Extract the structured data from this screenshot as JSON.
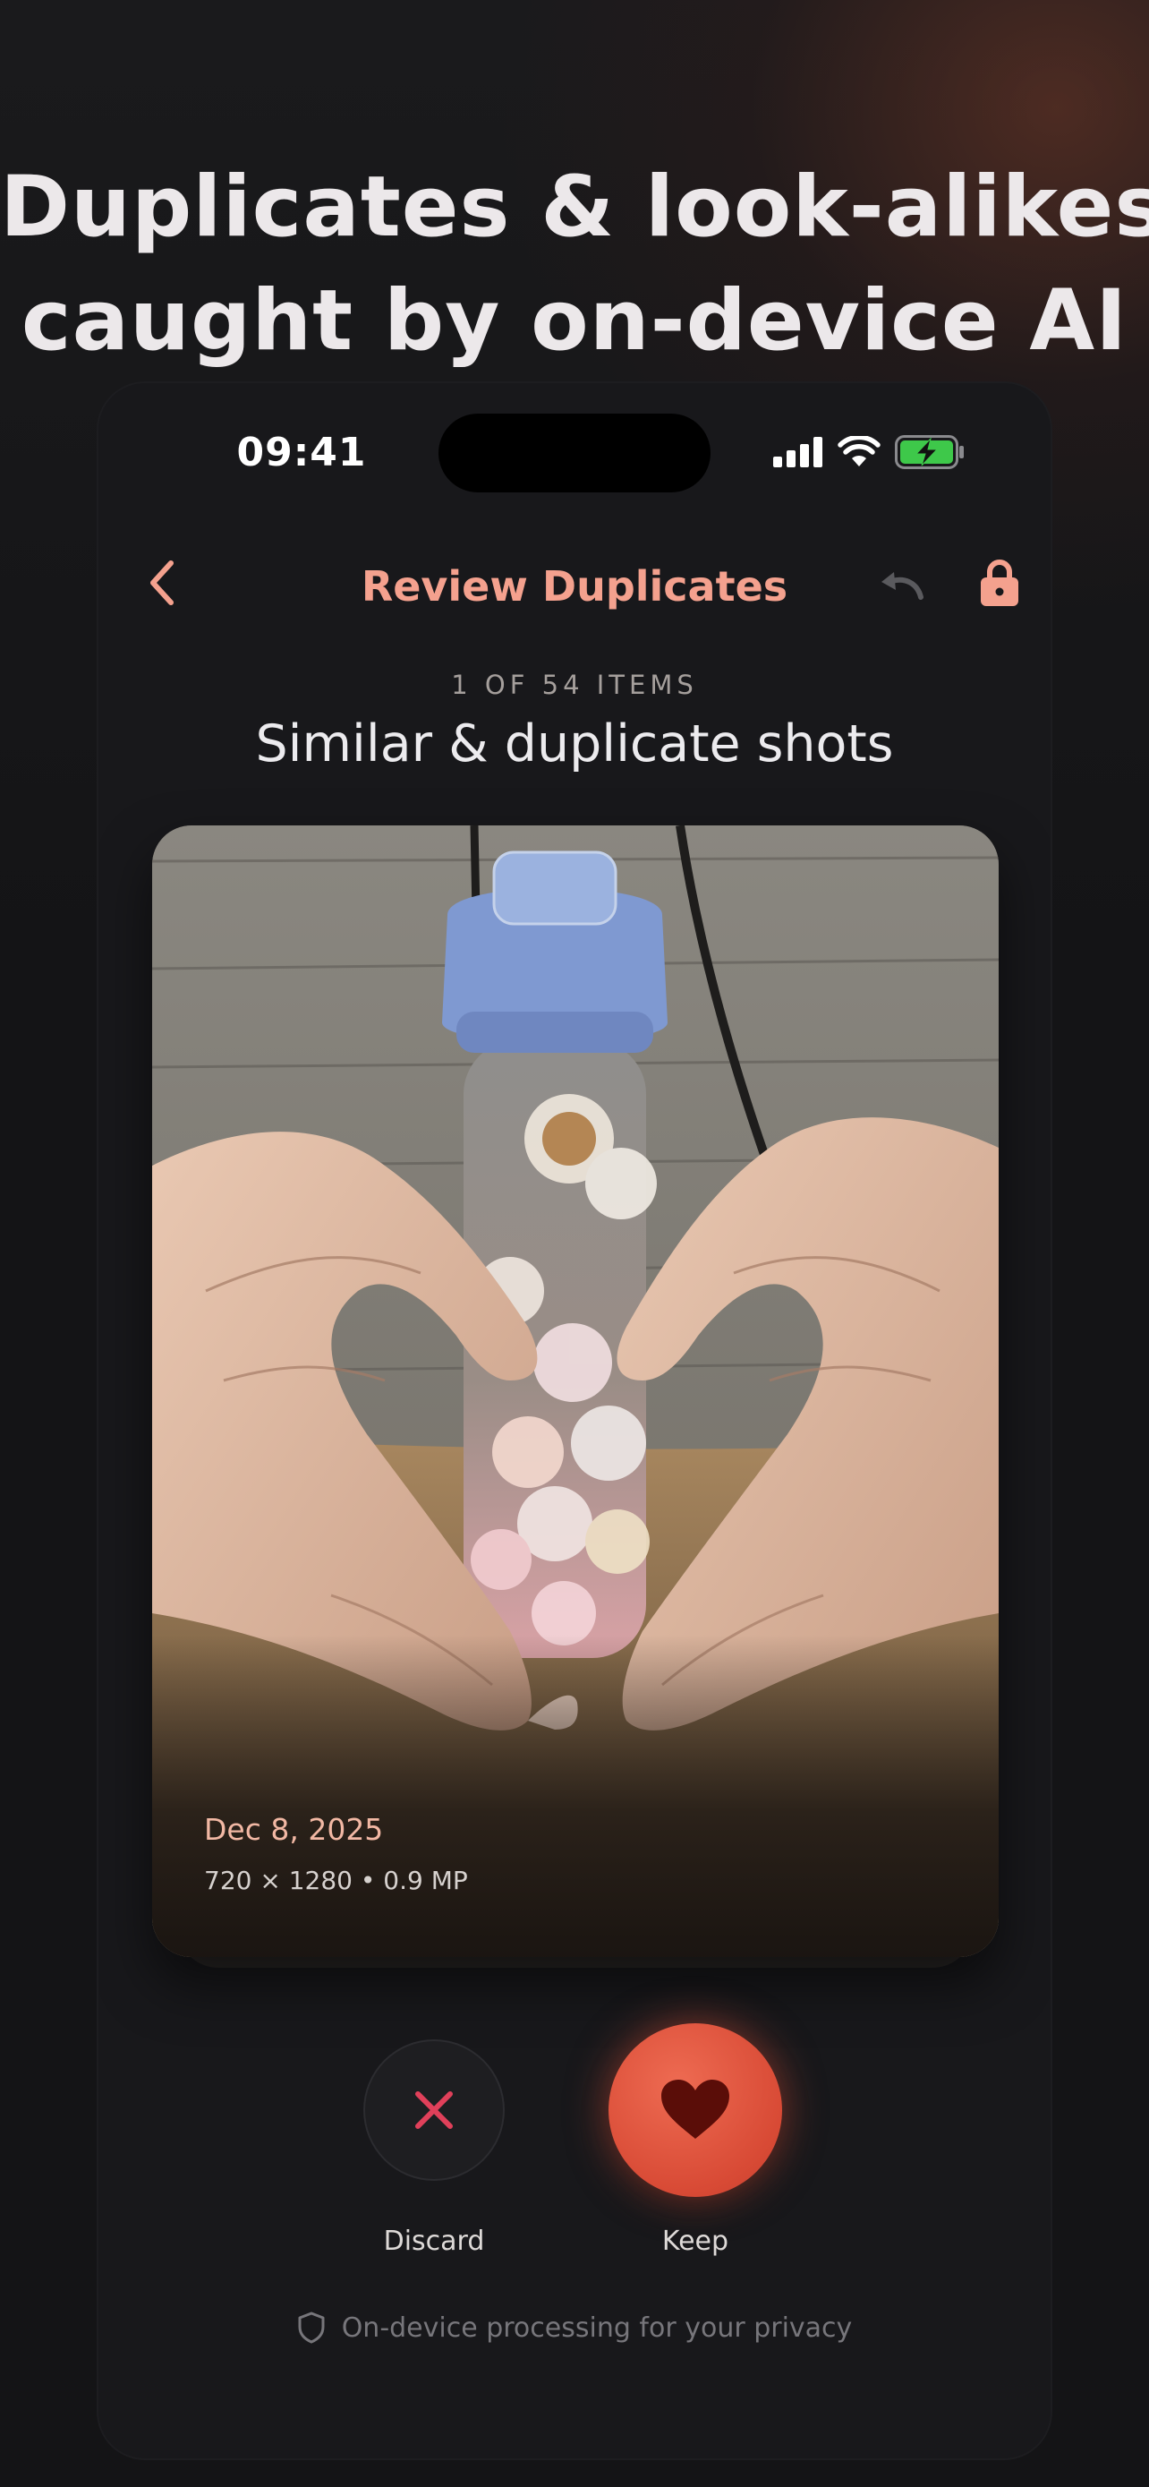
{
  "headline": {
    "line1": "Duplicates & look-alikes,",
    "line2": "caught by on-device AI"
  },
  "status_bar": {
    "time": "09:41",
    "icons": [
      "cellular-signal-icon",
      "wifi-icon",
      "battery-charging-icon"
    ]
  },
  "nav": {
    "title": "Review Duplicates",
    "back_icon": "chevron-left-icon",
    "undo_icon": "undo-icon",
    "lock_icon": "lock-icon"
  },
  "review": {
    "counter": "1 OF 54 ITEMS",
    "title": "Similar & duplicate shots"
  },
  "photo": {
    "date": "Dec 8, 2025",
    "meta": "720 × 1280 • 0.9 MP"
  },
  "actions": {
    "discard_label": "Discard",
    "keep_label": "Keep",
    "discard_icon": "close-icon",
    "keep_icon": "heart-icon"
  },
  "footer": {
    "privacy_text": "On-device processing for your privacy",
    "privacy_icon": "shield-icon"
  },
  "colors": {
    "accent": "#f4a18e",
    "keep": "#e05a44",
    "discard_x": "#e0405a",
    "background": "#141416"
  }
}
